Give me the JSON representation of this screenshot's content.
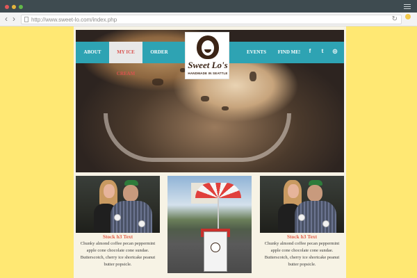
{
  "browser": {
    "url": "http://www.sweet-lo.com/index.php",
    "back_icon": "chevron-left-icon",
    "forward_icon": "chevron-right-icon",
    "reload_icon": "reload-icon"
  },
  "nav": {
    "items": [
      {
        "label": "ABOUT",
        "active": false
      },
      {
        "label": "MY ICE CREAM",
        "active": true
      },
      {
        "label": "ORDER",
        "active": false
      },
      {
        "label": "EVENTS",
        "active": false
      },
      {
        "label": "FIND ME!",
        "active": false
      }
    ],
    "social": [
      {
        "icon": "facebook-icon",
        "glyph": "f"
      },
      {
        "icon": "twitter-icon",
        "glyph": "t"
      },
      {
        "icon": "instagram-icon",
        "glyph": "◎"
      }
    ]
  },
  "logo": {
    "brand": "Sweet Lo's",
    "tagline": "HANDMADE IN SEATTLE"
  },
  "features": [
    {
      "title": "Stock h3 Text",
      "body": "Chunky almond coffee pecan peppermint apple cone chocolate cone sundae. Butterscotch, cherry ice shortcake peanut butter popsicle."
    },
    {
      "title": "Stock h3 Text",
      "body": "Chunky almond coffee pecan peppermint apple cone chocolate cone sundae. Butterscotch, cherry ice shortcake peanut butter popsicle."
    }
  ],
  "colors": {
    "background": "#ffe873",
    "nav": "#2ea3b3",
    "accent": "#e0604b",
    "page": "#f7f3e5"
  }
}
